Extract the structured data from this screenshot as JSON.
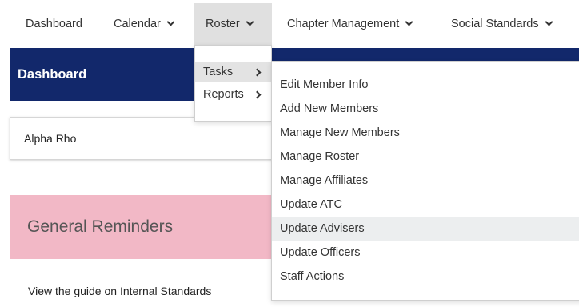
{
  "nav": {
    "items": [
      {
        "label": "Dashboard",
        "has_dropdown": false
      },
      {
        "label": "Calendar",
        "has_dropdown": true
      },
      {
        "label": "Roster",
        "has_dropdown": true,
        "active": true
      },
      {
        "label": "Chapter Management",
        "has_dropdown": true
      },
      {
        "label": "Social Standards",
        "has_dropdown": true
      }
    ]
  },
  "dashboard": {
    "title": "Dashboard",
    "chapter_name": "Alpha Rho"
  },
  "reminders": {
    "title": "General Reminders",
    "body_text": "View the guide on Internal Standards"
  },
  "roster_menu": {
    "items": [
      {
        "label": "Tasks",
        "has_submenu": true,
        "active": true
      },
      {
        "label": "Reports",
        "has_submenu": true
      }
    ]
  },
  "tasks_menu": {
    "items": [
      {
        "label": "Edit Member Info"
      },
      {
        "label": "Add New Members"
      },
      {
        "label": "Manage New Members"
      },
      {
        "label": "Manage Roster"
      },
      {
        "label": "Manage Affiliates"
      },
      {
        "label": "Update ATC"
      },
      {
        "label": "Update Advisers",
        "highlighted": true
      },
      {
        "label": "Update Officers"
      },
      {
        "label": "Staff Actions"
      }
    ]
  },
  "colors": {
    "dashboard_bar": "#12286b",
    "reminders_header": "#f2b8c6",
    "active_nav": "#e0e0e0",
    "hover_item": "#eceeef"
  },
  "icons": {
    "nav_dropdown": "chevron-down-icon",
    "submenu": "chevron-right-icon"
  }
}
